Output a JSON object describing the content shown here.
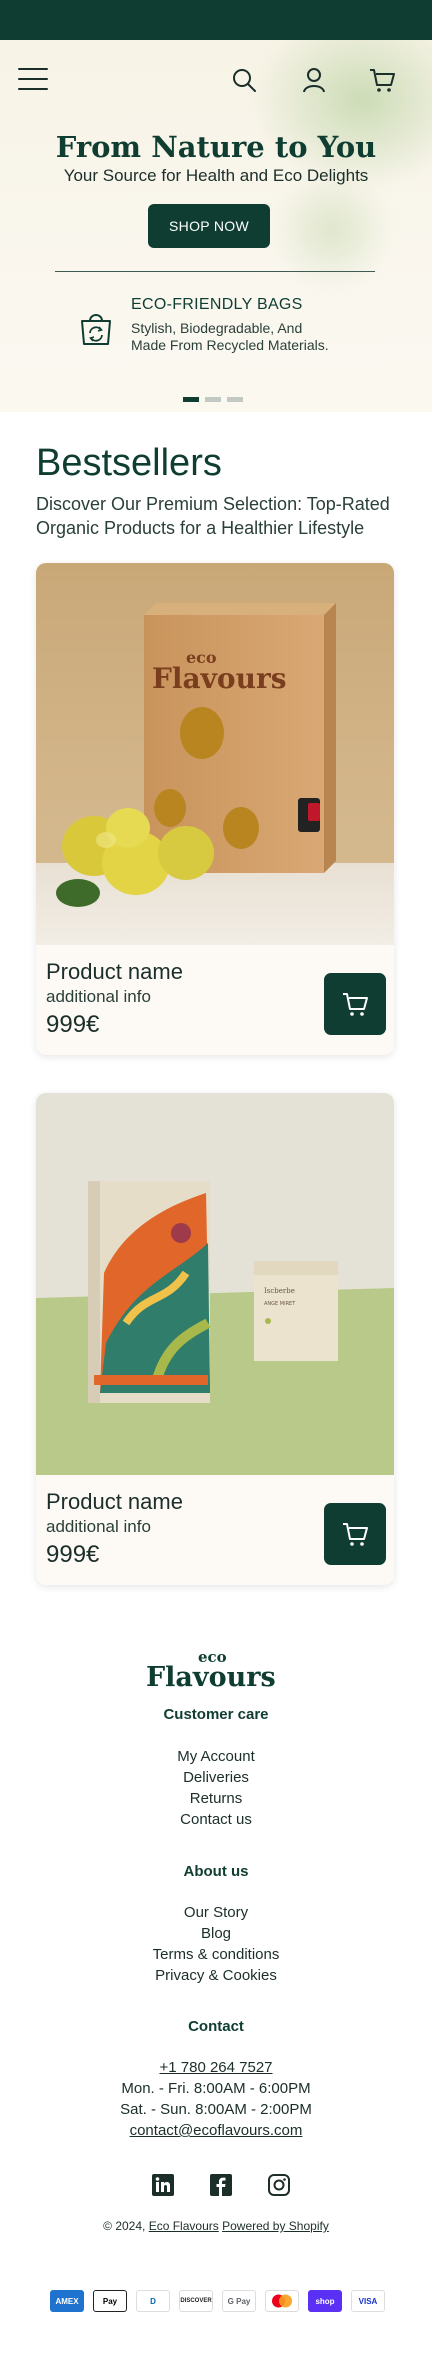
{
  "hero": {
    "title": "From Nature to You",
    "subtitle": "Your Source for Health and Eco Delights",
    "cta_label": "SHOP NOW",
    "feature_title": "ECO-FRIENDLY BAGS",
    "feature_line1": "Stylish, Biodegradable, And",
    "feature_line2": "Made From Recycled Materials.",
    "slides": 3,
    "active_slide": 1
  },
  "bestsellers": {
    "title": "Bestsellers",
    "description": "Discover Our Premium Selection: Top-Rated Organic Products for a Healthier Lifestyle",
    "products": [
      {
        "name": "Product name",
        "info": "additional info",
        "price": "999€",
        "image": "cider-box-with-quinces"
      },
      {
        "name": "Product name",
        "info": "additional info",
        "price": "999€",
        "image": "tea-box-and-pouch"
      }
    ]
  },
  "footer": {
    "brand_line1": "eco",
    "brand_line2": "Flavours",
    "customer_care": {
      "heading": "Customer care",
      "links": [
        "My Account",
        "Deliveries",
        "Returns",
        "Contact us"
      ]
    },
    "about": {
      "heading": "About us",
      "links": [
        "Our Story",
        "Blog",
        "Terms & conditions",
        "Privacy & Cookies"
      ]
    },
    "contact": {
      "heading": "Contact",
      "phone": "+1 780 264 7527",
      "hours_weekday": "Mon. - Fri. 8:00AM - 6:00PM",
      "hours_weekend": "Sat. - Sun. 8:00AM - 2:00PM",
      "email": "contact@ecoflavours.com"
    },
    "socials": [
      "linkedin-icon",
      "facebook-icon",
      "instagram-icon"
    ],
    "copyright_prefix": "© 2024,",
    "copyright_brand": "Eco Flavours",
    "copyright_powered": "Powered by Shopify",
    "payments": [
      {
        "label": "AMEX",
        "bg": "#1f72cd",
        "fg": "#ffffff"
      },
      {
        "label": "Pay",
        "bg": "#ffffff",
        "fg": "#000000"
      },
      {
        "label": "D",
        "bg": "#ffffff",
        "fg": "#0066b2"
      },
      {
        "label": "DISCOVER",
        "bg": "#ffffff",
        "fg": "#231f20"
      },
      {
        "label": "G Pay",
        "bg": "#ffffff",
        "fg": "#5f6368"
      },
      {
        "label": "MC",
        "bg": "#ffffff",
        "fg": "#eb001b"
      },
      {
        "label": "shop",
        "bg": "#5a31f4",
        "fg": "#ffffff"
      },
      {
        "label": "VISA",
        "bg": "#ffffff",
        "fg": "#1434cb"
      }
    ]
  },
  "colors": {
    "brand_dark": "#0f3d32",
    "hero_bg": "#f7f3e6",
    "card_bg": "#fdfaf6"
  }
}
